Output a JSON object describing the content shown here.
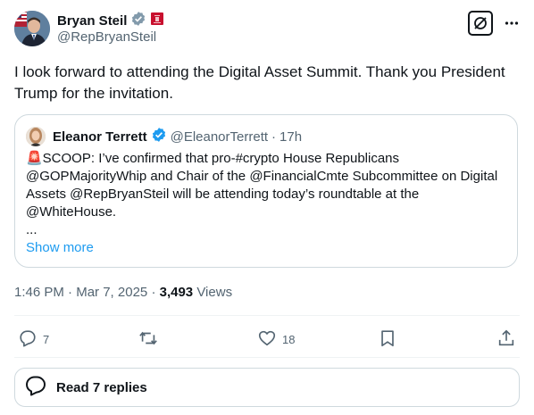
{
  "author": {
    "name": "Bryan Steil",
    "handle": "@RepBryanSteil",
    "badges": [
      "verified-gray-icon",
      "us-house-seal-icon"
    ]
  },
  "post": {
    "text": "I look forward to attending the Digital Asset Summit. Thank you President Trump for the invitation."
  },
  "quote": {
    "author_name": "Eleanor Terrett",
    "author_handle": "@EleanorTerrett",
    "time_sep": "·",
    "time": "17h",
    "text": "🚨SCOOP: I’ve confirmed that pro-#crypto House Republicans @GOPMajorityWhip and Chair of the @FinancialCmte Subcommittee on Digital Assets @RepBryanSteil will be attending today’s roundtable at the @WhiteHouse.",
    "ellipsis": "...",
    "show_more": "Show more"
  },
  "meta": {
    "time": "1:46 PM",
    "sep1": "·",
    "date": "Mar 7, 2025",
    "sep2": "·",
    "views_count": "3,493",
    "views_label": "Views"
  },
  "actions": {
    "replies": "7",
    "likes": "18"
  },
  "replies_button": {
    "label": "Read 7 replies"
  },
  "colors": {
    "text": "#0f1419",
    "secondary": "#536471",
    "accent": "#1d9bf0",
    "border": "#cfd9de"
  }
}
